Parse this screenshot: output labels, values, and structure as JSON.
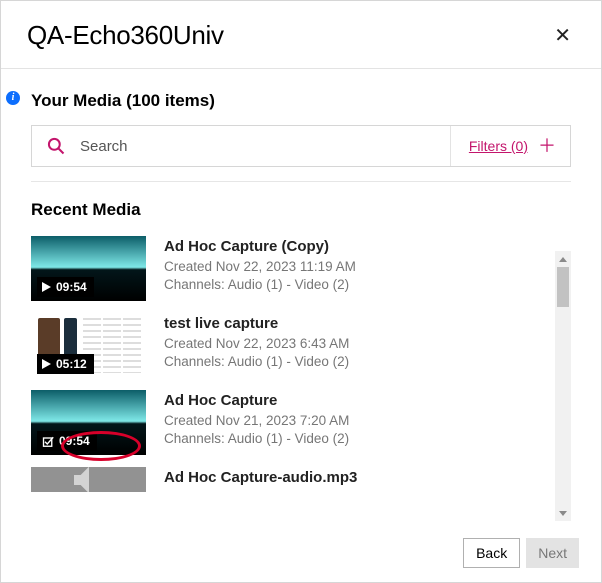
{
  "title": "QA-Echo360Univ",
  "your_media_heading": "Your Media (100 items)",
  "search_placeholder": "Search",
  "filters_label": "Filters (0)",
  "recent_media_heading": "Recent Media",
  "colors": {
    "accent": "#c3156c",
    "info": "#0d6efd",
    "highlight_ring": "#d7002a"
  },
  "media": [
    {
      "title": "Ad Hoc Capture (Copy)",
      "created": "Created Nov 22, 2023 11:19 AM",
      "channels": "Channels: Audio (1) - Video (2)",
      "duration": "09:54",
      "thumb": "landscape",
      "badge_icon": "play"
    },
    {
      "title": "test live capture",
      "created": "Created Nov 22, 2023 6:43 AM",
      "channels": "Channels: Audio (1) - Video (2)",
      "duration": "05:12",
      "thumb": "studio",
      "badge_icon": "play"
    },
    {
      "title": "Ad Hoc Capture",
      "created": "Created Nov 21, 2023 7:20 AM",
      "channels": "Channels: Audio (1) - Video (2)",
      "duration": "09:54",
      "thumb": "landscape",
      "badge_icon": "check",
      "highlighted": true
    },
    {
      "title": "Ad Hoc Capture-audio.mp3",
      "created": "",
      "channels": "",
      "duration": "",
      "thumb": "audio",
      "badge_icon": ""
    }
  ],
  "buttons": {
    "back": "Back",
    "next": "Next"
  }
}
